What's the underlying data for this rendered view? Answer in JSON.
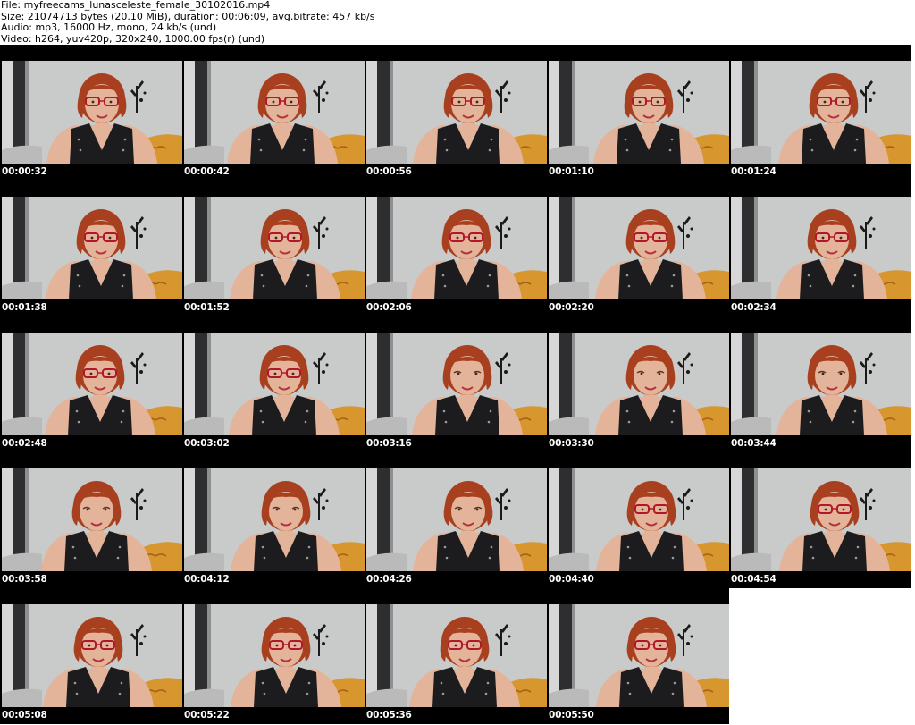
{
  "header": {
    "file": "File: myfreecams_lunasceleste_female_30102016.mp4",
    "size": "Size: 21074713 bytes (20.10 MiB), duration: 00:06:09, avg.bitrate: 457 kb/s",
    "audio": "Audio: mp3, 16000 Hz, mono, 24 kb/s (und)",
    "video": "Video: h264, yuv420p, 320x240, 1000.00 fps(r) (und)"
  },
  "thumbnails": [
    {
      "timestamp": "00:00:32"
    },
    {
      "timestamp": "00:00:42"
    },
    {
      "timestamp": "00:00:56"
    },
    {
      "timestamp": "00:01:10"
    },
    {
      "timestamp": "00:01:24"
    },
    {
      "timestamp": "00:01:38"
    },
    {
      "timestamp": "00:01:52"
    },
    {
      "timestamp": "00:02:06"
    },
    {
      "timestamp": "00:02:20"
    },
    {
      "timestamp": "00:02:34"
    },
    {
      "timestamp": "00:02:48"
    },
    {
      "timestamp": "00:03:02"
    },
    {
      "timestamp": "00:03:16"
    },
    {
      "timestamp": "00:03:30"
    },
    {
      "timestamp": "00:03:44"
    },
    {
      "timestamp": "00:03:58"
    },
    {
      "timestamp": "00:04:12"
    },
    {
      "timestamp": "00:04:26"
    },
    {
      "timestamp": "00:04:40"
    },
    {
      "timestamp": "00:04:54"
    },
    {
      "timestamp": "00:05:08"
    },
    {
      "timestamp": "00:05:22"
    },
    {
      "timestamp": "00:05:36"
    },
    {
      "timestamp": "00:05:50"
    }
  ],
  "colors": {
    "background": "#ffffff",
    "cell_background": "#000000",
    "timestamp_text": "#ffffff",
    "wall": "#c9cbca",
    "hair": "#a8401f",
    "skin": "#e3b49a",
    "glasses": "#b0182a",
    "vest": "#1c1c1e",
    "sofa": "#d8962e"
  }
}
